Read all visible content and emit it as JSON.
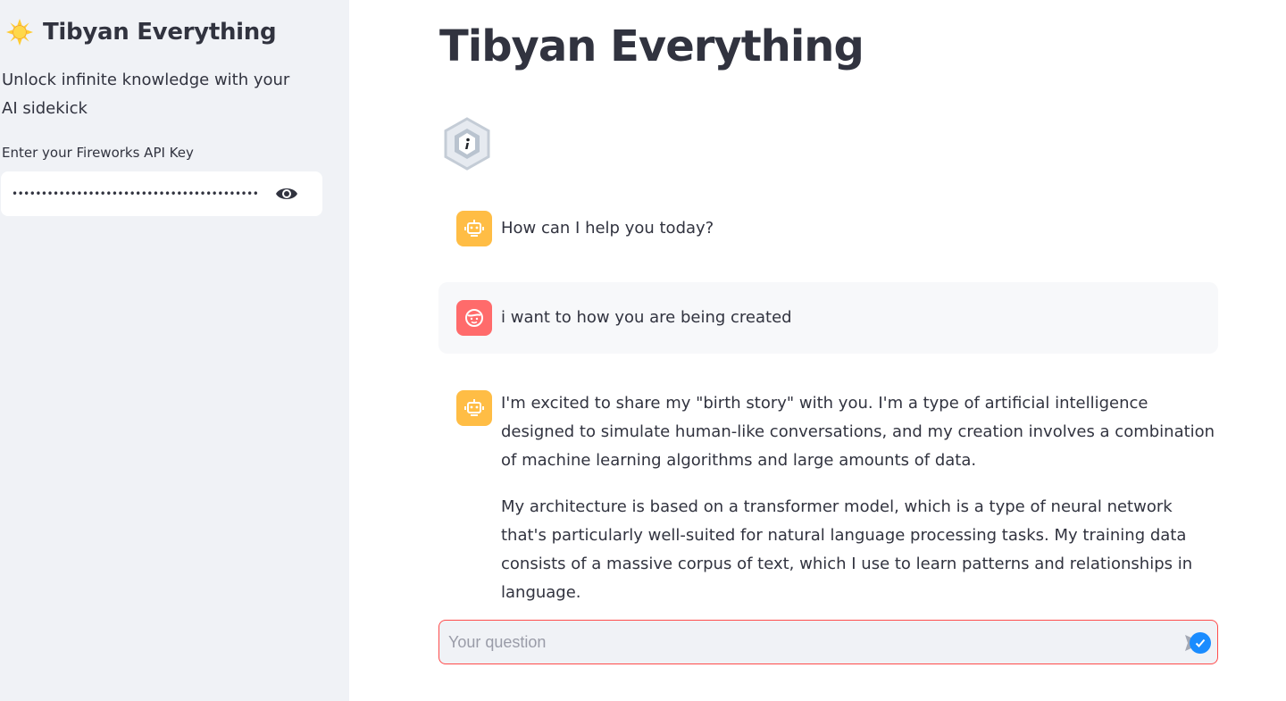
{
  "sidebar": {
    "icon": "sun-icon",
    "title": "Tibyan Everything",
    "subtitle": "Unlock infinite knowledge with your AI sidekick",
    "api_key_label": "Enter your Fireworks API Key",
    "api_key_value": "••••••••••••••••••••••••••••••••••••••••••••••••",
    "toggle_icon": "eye-icon"
  },
  "main": {
    "title": "Tibyan Everything",
    "logo_icon": "info-hexagon-icon",
    "messages": [
      {
        "role": "assistant",
        "avatar_icon": "robot-icon",
        "paragraphs": [
          "How can I help you today?"
        ]
      },
      {
        "role": "user",
        "avatar_icon": "smiley-face-icon",
        "paragraphs": [
          "i want to how you are being created"
        ]
      },
      {
        "role": "assistant",
        "avatar_icon": "robot-icon",
        "paragraphs": [
          "I'm excited to share my \"birth story\" with you. I'm a type of artificial intelligence designed to simulate human-like conversations, and my creation involves a combination of machine learning algorithms and large amounts of data.",
          "My architecture is based on a transformer model, which is a type of neural network that's particularly well-suited for natural language processing tasks. My training data consists of a massive corpus of text, which I use to learn patterns and relationships in language."
        ]
      }
    ],
    "chat_input": {
      "placeholder": "Your question",
      "value": "",
      "send_icon": "send-icon"
    }
  },
  "colors": {
    "sidebar_bg": "#f0f2f6",
    "assistant_avatar": "#ffbd45",
    "user_avatar": "#ff6b6b",
    "input_border": "#ff4b4b",
    "text": "#31333f"
  }
}
